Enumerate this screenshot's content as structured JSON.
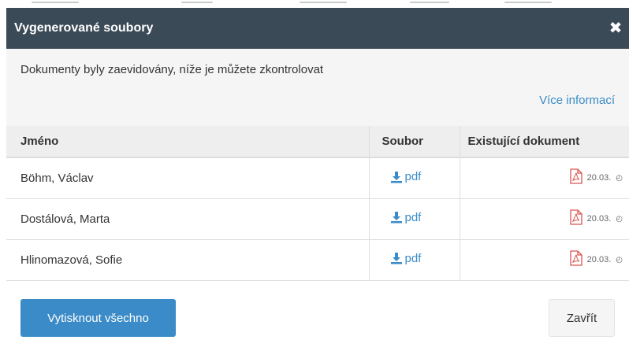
{
  "dialog": {
    "title": "Vygenerované soubory",
    "close_icon": "close-icon",
    "close_glyph": "✖",
    "intro_text": "Dokumenty byly zaevidovány, níže je můžete zkontrolovat",
    "more_link": "Více informací"
  },
  "table": {
    "headers": {
      "name": "Jméno",
      "file": "Soubor",
      "existing": "Existující dokument"
    },
    "rows": [
      {
        "name": "Böhm, Václav",
        "file": "pdf",
        "existing_date": "20.03.",
        "existing_icon": "pdf-file-icon"
      },
      {
        "name": "Dostálová, Marta",
        "file": "pdf",
        "existing_date": "20.03.",
        "existing_icon": "pdf-file-icon"
      },
      {
        "name": "Hlinomazová, Sofie",
        "file": "pdf",
        "existing_date": "20.03.",
        "existing_icon": "pdf-file-icon"
      }
    ],
    "download_icon": "download-icon"
  },
  "footer": {
    "print_all_label": "Vytisknout všechno",
    "close_label": "Zavřít"
  },
  "colors": {
    "header_bg": "#3b4a57",
    "accent": "#3a8bc7",
    "pdf_icon": "#d9534f"
  }
}
